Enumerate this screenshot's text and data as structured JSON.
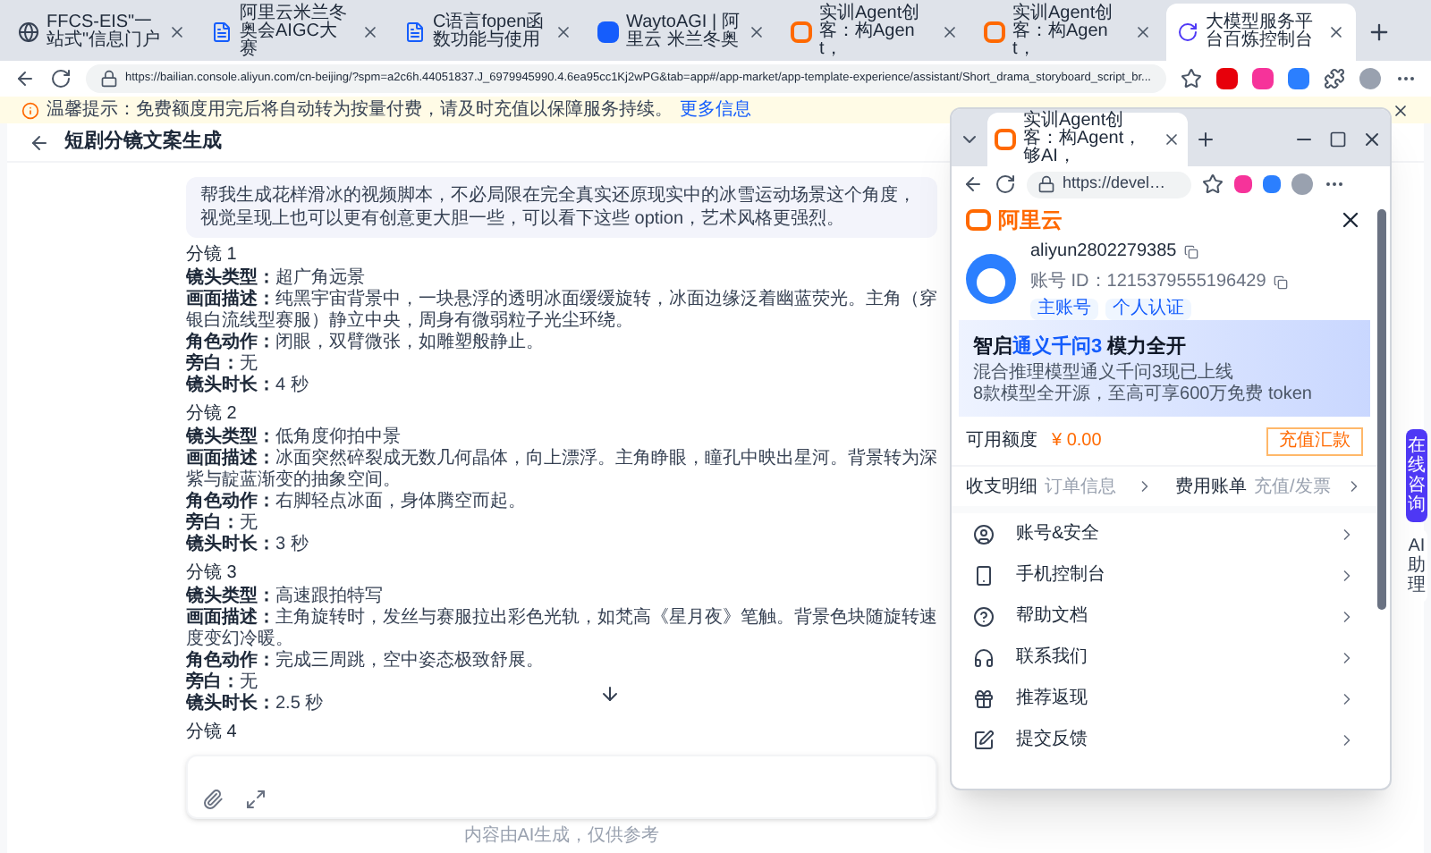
{
  "browser": {
    "tabs": [
      {
        "title": "FFCS-EIS\"一站式\"信息门户",
        "selected": false,
        "kind": "globe"
      },
      {
        "title": "阿里云米兰冬奥会AIGC大赛",
        "selected": false,
        "kind": "doc"
      },
      {
        "title": "C语言fopen函数功能与使用",
        "selected": false,
        "kind": "doc"
      },
      {
        "title": "WaytoAGI | 阿里云 米兰冬奥",
        "selected": false,
        "kind": "page"
      },
      {
        "title": "实训Agent创客：构Agent，",
        "selected": false,
        "kind": "aliyun"
      },
      {
        "title": "实训Agent创客：构Agent，",
        "selected": false,
        "kind": "aliyun"
      },
      {
        "title": "大模型服务平台百炼控制台",
        "selected": true,
        "kind": "swirl"
      }
    ],
    "url": "https://bailian.console.aliyun.com/cn-beijing/?spm=a2c6h.44051837.J_6979945990.4.6ea95cc1Kj2wPG&tab=app#/app-market/app-template-experience/assistant/Short_drama_storyboard_script_br..."
  },
  "notice": {
    "text": "温馨提示：免费额度用完后将自动转为按量付费，请及时充值以保障服务持续。",
    "link": "更多信息"
  },
  "page": {
    "title": "短剧分镜文案生成",
    "user_message": "帮我生成花样滑冰的视频脚本，不必局限在完全真实还原现实中的冰雪运动场景这个角度，视觉呈现上也可以更有创意更大胆一些，可以看下这些 option，艺术风格更强烈。",
    "shots": [
      {
        "heading": "分镜 1",
        "fields": [
          {
            "label": "镜头类型：",
            "value": "超广角远景"
          },
          {
            "label": "画面描述：",
            "value": "纯黑宇宙背景中，一块悬浮的透明冰面缓缓旋转，冰面边缘泛着幽蓝荧光。主角（穿银白流线型赛服）静立中央，周身有微弱粒子光尘环绕。"
          },
          {
            "label": "角色动作：",
            "value": "闭眼，双臂微张，如雕塑般静止。"
          },
          {
            "label": "旁白：",
            "value": "无"
          },
          {
            "label": "镜头时长：",
            "value": "4 秒"
          }
        ]
      },
      {
        "heading": "分镜 2",
        "fields": [
          {
            "label": "镜头类型：",
            "value": "低角度仰拍中景"
          },
          {
            "label": "画面描述：",
            "value": "冰面突然碎裂成无数几何晶体，向上漂浮。主角睁眼，瞳孔中映出星河。背景转为深紫与靛蓝渐变的抽象空间。"
          },
          {
            "label": "角色动作：",
            "value": "右脚轻点冰面，身体腾空而起。"
          },
          {
            "label": "旁白：",
            "value": "无"
          },
          {
            "label": "镜头时长：",
            "value": "3 秒"
          }
        ]
      },
      {
        "heading": "分镜 3",
        "fields": [
          {
            "label": "镜头类型：",
            "value": "高速跟拍特写"
          },
          {
            "label": "画面描述：",
            "value": "主角旋转时，发丝与赛服拉出彩色光轨，如梵高《星月夜》笔触。背景色块随旋转速度变幻冷暖。"
          },
          {
            "label": "角色动作：",
            "value": "完成三周跳，空中姿态极致舒展。"
          },
          {
            "label": "旁白：",
            "value": "无"
          },
          {
            "label": "镜头时长：",
            "value": "2.5 秒"
          }
        ]
      },
      {
        "heading": "分镜 4"
      }
    ],
    "footer_note": "内容由AI生成，仅供参考"
  },
  "side_widget": {
    "items": [
      "在线咨询",
      "AI助理"
    ]
  },
  "popup": {
    "tab_title": "实训Agent创客：构Agent，够AI，",
    "url": "https://devel…",
    "brand": "阿里云",
    "account": {
      "name": "aliyun2802279385",
      "id_label": "账号 ID：",
      "id": "1215379555196429",
      "tags": [
        "主账号",
        "个人认证"
      ]
    },
    "banner": {
      "lead": "智启",
      "highlight": "通义千问3",
      "tail": "模力全开",
      "lines": [
        "混合推理模型通义千问3现已上线",
        "8款模型全开源，至高可享600万免费 token"
      ]
    },
    "balance": {
      "label": "可用额度",
      "amount": "¥ 0.00",
      "button": "充值汇款"
    },
    "links": [
      {
        "title": "收支明细",
        "hint": "订单信息"
      },
      {
        "title": "费用账单",
        "hint": "充值/发票"
      }
    ],
    "menu": [
      {
        "label": "账号&安全",
        "kind": "account"
      },
      {
        "label": "手机控制台",
        "kind": "phone"
      },
      {
        "label": "帮助文档",
        "kind": "help"
      },
      {
        "label": "联系我们",
        "kind": "contact"
      },
      {
        "label": "推荐返现",
        "kind": "referral"
      },
      {
        "label": "提交反馈",
        "kind": "feedback"
      }
    ]
  }
}
